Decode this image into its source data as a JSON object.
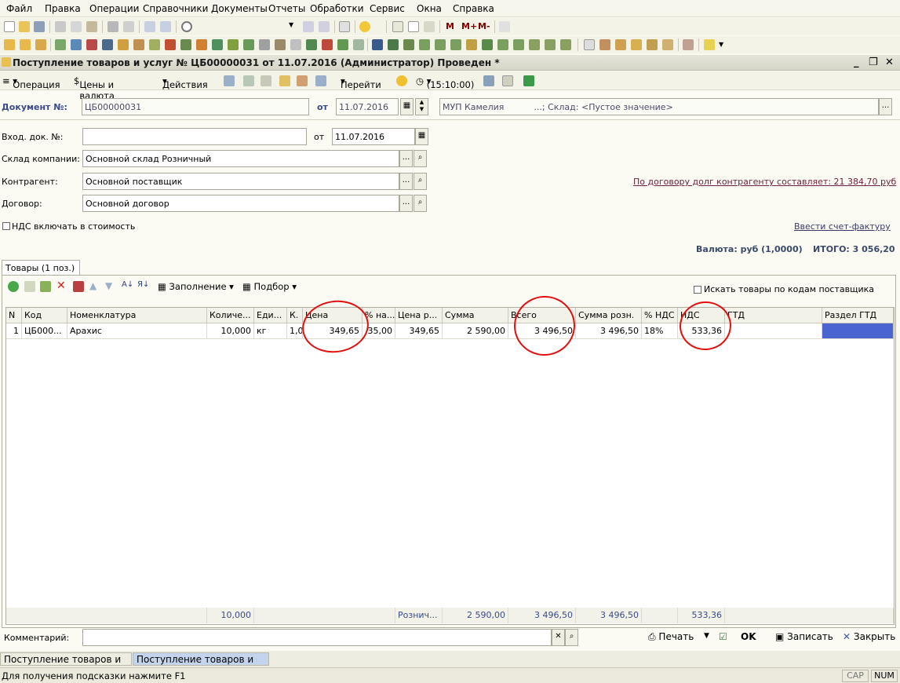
{
  "menu": [
    "Файл",
    "Правка",
    "Операции",
    "Справочники",
    "Документы",
    "Отчеты",
    "Обработки",
    "Сервис",
    "Окна",
    "Справка"
  ],
  "toolbar": {
    "m_labels": [
      "M",
      "M+",
      "M-"
    ]
  },
  "window": {
    "title": "Поступление товаров и услуг № ЦБ00000031 от 11.07.2016 (Администратор) Проведен *"
  },
  "doc_toolbar": {
    "operation": "Операция",
    "prices": "Цены и валюта",
    "actions": "Действия",
    "goto": "Перейти",
    "time": "(15:10:00)"
  },
  "header": {
    "doc_no_label": "Документ №:",
    "doc_no": "ЦБ00000031",
    "from_label": "от",
    "date": "11.07.2016",
    "org": "МУП Камелия",
    "warehouse_text": "...; Склад: <Пустое значение>"
  },
  "form": {
    "in_doc_label": "Вход. док. №:",
    "in_doc_value": "",
    "in_from_label": "от",
    "in_date": "11.07.2016",
    "warehouse_label": "Склад компании:",
    "warehouse": "Основной склад Розничный",
    "counterparty_label": "Контрагент:",
    "counterparty": "Основной поставщик",
    "contract_label": "Договор:",
    "contract": "Основной договор",
    "vat_checkbox": "НДС включать в стоимость",
    "debt_link": "По договору долг контрагенту составляет: 21 384,70 руб",
    "invoice_link": "Ввести счет-фактуру",
    "currency": "Валюта: руб (1,0000)",
    "total": "ИТОГО: 3 056,20"
  },
  "tabs": {
    "goods": "Товары (1 поз.)"
  },
  "table_toolbar": {
    "fill": "Заполнение",
    "select": "Подбор",
    "search_checkbox": "Искать товары по кодам поставщика"
  },
  "table": {
    "columns": [
      "N",
      "Код",
      "Номенклатура",
      "Количе...",
      "Еди...",
      "К.",
      "Цена",
      "% на...",
      "Цена р...",
      "Сумма",
      "Всего",
      "Сумма розн.",
      "% НДС",
      "НДС",
      "ГТД",
      "Раздел ГТД"
    ],
    "rows": [
      [
        "1",
        "ЦБ000...",
        "Арахис",
        "10,000",
        "кг",
        "1,0",
        "349,65",
        "35,00",
        "349,65",
        "2 590,00",
        "3 496,50",
        "3 496,50",
        "18%",
        "533,36",
        "",
        ""
      ]
    ],
    "footer": {
      "qty": "10,000",
      "retail": "Рознич...",
      "sum": "2 590,00",
      "total": "3 496,50",
      "retail_sum": "3 496,50",
      "vat": "533,36"
    }
  },
  "bottom": {
    "comment_label": "Комментарий:",
    "comment": "",
    "print": "Печать",
    "ok": "OK",
    "save": "Записать",
    "close": "Закрыть"
  },
  "taskbar": [
    "Поступление товаров и ...",
    "Поступление товаров и ..."
  ],
  "status": {
    "hint": "Для получения подсказки нажмите F1",
    "cap": "CAP",
    "num": "NUM"
  }
}
